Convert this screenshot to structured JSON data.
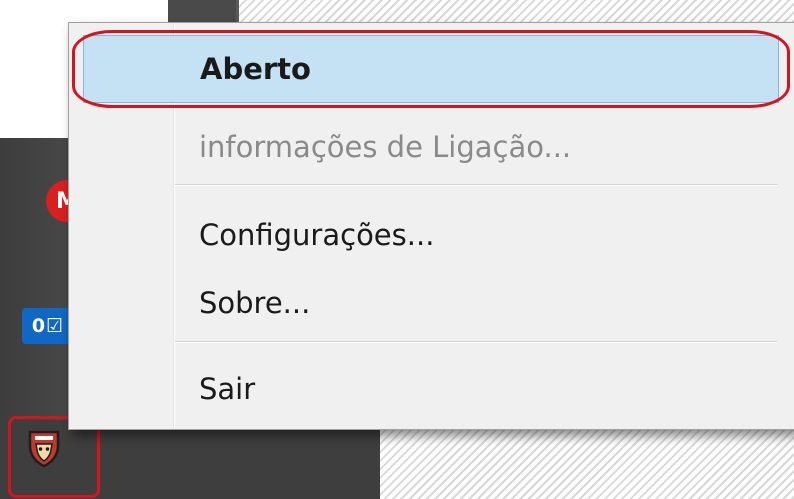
{
  "tray": {
    "icons": [
      {
        "name": "mega-icon",
        "glyph": "M",
        "color": "#d92020"
      },
      {
        "name": "outlook-icon",
        "glyph": "0☑",
        "color": "#1068c4"
      },
      {
        "name": "app-shield-icon",
        "color": "#c0392b"
      }
    ]
  },
  "menu": {
    "items": [
      {
        "label": "Aberto",
        "bold": true,
        "highlighted": true,
        "enabled": true
      },
      {
        "label": "informações de Ligação...",
        "enabled": false
      },
      {
        "label": "Configurações...",
        "enabled": true
      },
      {
        "label": "Sobre...",
        "enabled": true
      },
      {
        "label": "Sair",
        "enabled": true
      }
    ]
  },
  "colors": {
    "highlight_bg": "#c5e2f5",
    "annotation_red": "#d4141e",
    "menu_bg": "#f0f0f0"
  }
}
